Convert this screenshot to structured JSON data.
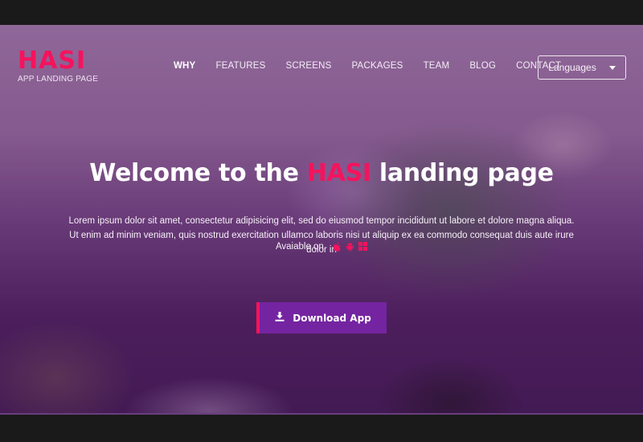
{
  "logo": {
    "title": "HASI",
    "subtitle": "APP LANDING PAGE"
  },
  "nav": {
    "items": [
      {
        "label": "WHY",
        "active": true
      },
      {
        "label": "FEATURES",
        "active": false
      },
      {
        "label": "SCREENS",
        "active": false
      },
      {
        "label": "PACKAGES",
        "active": false
      },
      {
        "label": "TEAM",
        "active": false
      },
      {
        "label": "BLOG",
        "active": false
      },
      {
        "label": "CONTACT",
        "active": false
      }
    ],
    "language_label": "Languages"
  },
  "hero": {
    "headline_pre": "Welcome to the",
    "headline_brand": "HASI",
    "headline_post": "landing page",
    "paragraph": "Lorem ipsum dolor sit amet, consectetur adipisicing elit, sed do eiusmod tempor incididunt ut labore et dolore magna aliqua. Ut enim ad minim veniam, quis nostrud exercitation ullamco laboris nisi ut aliquip ex ea commodo consequat duis aute irure dolor in",
    "available_label": "Avaiable on",
    "platform_icons": [
      "apple-icon",
      "android-icon",
      "windows-icon"
    ],
    "download_label": "Download App"
  },
  "colors": {
    "accent": "#f5135d",
    "button": "#7424a0"
  }
}
